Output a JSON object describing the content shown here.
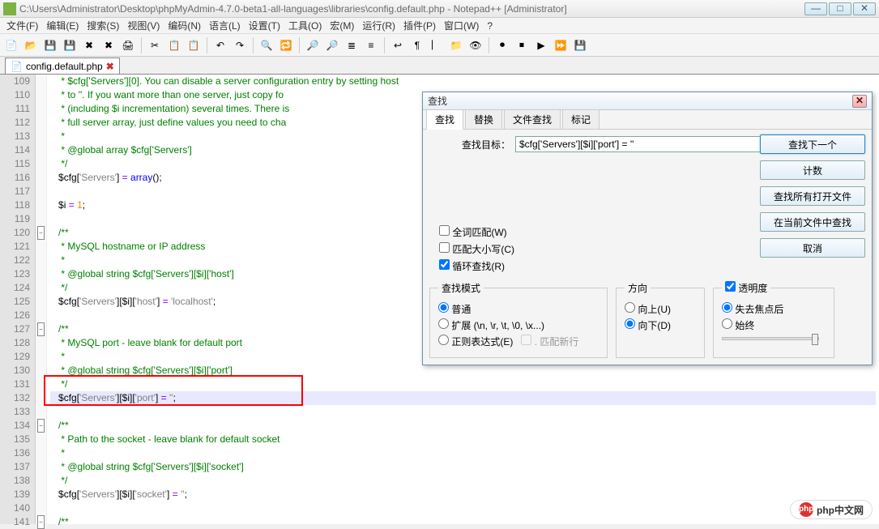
{
  "window": {
    "title": "C:\\Users\\Administrator\\Desktop\\phpMyAdmin-4.7.0-beta1-all-languages\\libraries\\config.default.php - Notepad++ [Administrator]"
  },
  "menus": [
    "文件(F)",
    "编辑(E)",
    "搜索(S)",
    "视图(V)",
    "编码(N)",
    "语言(L)",
    "设置(T)",
    "工具(O)",
    "宏(M)",
    "运行(R)",
    "插件(P)",
    "窗口(W)",
    "?"
  ],
  "tab": {
    "filename": "config.default.php"
  },
  "lines": [
    {
      "n": 109,
      "html": "    <span class='cm'>* $cfg['Servers'][0]. You can disable a server configuration entry by setting host</span>"
    },
    {
      "n": 110,
      "html": "    <span class='cm'>* to ''. If you want more than one server, just copy fo</span>"
    },
    {
      "n": 111,
      "html": "    <span class='cm'>* (including $i incrementation) several times. There is</span>"
    },
    {
      "n": 112,
      "html": "    <span class='cm'>* full server array, just define values you need to cha</span>"
    },
    {
      "n": 113,
      "html": "    <span class='cm'>*</span>"
    },
    {
      "n": 114,
      "html": "    <span class='cm'>* @global array $cfg['Servers']</span>"
    },
    {
      "n": 115,
      "html": "    <span class='cm'>*/</span>"
    },
    {
      "n": 116,
      "html": "   <span class='va'>$cfg</span>[<span class='st'>'Servers'</span>] <span class='op'>=</span> <span class='kw'>array</span>();"
    },
    {
      "n": 117,
      "html": ""
    },
    {
      "n": 118,
      "html": "   <span class='va'>$i</span> <span class='op'>=</span> <span class='nu'>1</span>;"
    },
    {
      "n": 119,
      "html": ""
    },
    {
      "n": 120,
      "html": "   <span class='cm'>/**</span>",
      "fold": "-"
    },
    {
      "n": 121,
      "html": "    <span class='cm'>* MySQL hostname or IP address</span>"
    },
    {
      "n": 122,
      "html": "    <span class='cm'>*</span>"
    },
    {
      "n": 123,
      "html": "    <span class='cm'>* @global string $cfg['Servers'][$i]['host']</span>"
    },
    {
      "n": 124,
      "html": "    <span class='cm'>*/</span>"
    },
    {
      "n": 125,
      "html": "   <span class='va'>$cfg</span>[<span class='st'>'Servers'</span>][<span class='va'>$i</span>][<span class='st'>'host'</span>] <span class='op'>=</span> <span class='st'>'localhost'</span>;"
    },
    {
      "n": 126,
      "html": ""
    },
    {
      "n": 127,
      "html": "   <span class='cm'>/**</span>",
      "fold": "-"
    },
    {
      "n": 128,
      "html": "    <span class='cm'>* MySQL port - leave blank for default port</span>"
    },
    {
      "n": 129,
      "html": "    <span class='cm'>*</span>"
    },
    {
      "n": 130,
      "html": "    <span class='cm'>* @global string $cfg['Servers'][$i]['port']</span>"
    },
    {
      "n": 131,
      "html": "    <span class='cm'>*/</span>"
    },
    {
      "n": 132,
      "html": "   <span class='va'>$cfg</span>[<span class='st'>'Servers'</span>][<span class='va'>$i</span>][<span class='st'>'port'</span>] <span class='op'>=</span> <span class='st'>''</span>;",
      "hl": true
    },
    {
      "n": 133,
      "html": ""
    },
    {
      "n": 134,
      "html": "   <span class='cm'>/**</span>",
      "fold": "-"
    },
    {
      "n": 135,
      "html": "    <span class='cm'>* Path to the socket - leave blank for default socket</span>"
    },
    {
      "n": 136,
      "html": "    <span class='cm'>*</span>"
    },
    {
      "n": 137,
      "html": "    <span class='cm'>* @global string $cfg['Servers'][$i]['socket']</span>"
    },
    {
      "n": 138,
      "html": "    <span class='cm'>*/</span>"
    },
    {
      "n": 139,
      "html": "   <span class='va'>$cfg</span>[<span class='st'>'Servers'</span>][<span class='va'>$i</span>][<span class='st'>'socket'</span>] <span class='op'>=</span> <span class='st'>''</span>;"
    },
    {
      "n": 140,
      "html": ""
    },
    {
      "n": 141,
      "html": "   <span class='cm'>/**</span>",
      "fold": "-"
    }
  ],
  "redbox": {
    "top_line": 131,
    "height_lines": 2
  },
  "find": {
    "title": "查找",
    "tabs": [
      "查找",
      "替换",
      "文件查找",
      "标记"
    ],
    "active_tab": 0,
    "target_label": "查找目标：",
    "target_value": "$cfg['Servers'][$i]['port'] = ''",
    "buttons": {
      "find_next": "查找下一个",
      "count": "计数",
      "find_all_open": "查找所有打开文件",
      "find_in_current": "在当前文件中查找",
      "cancel": "取消"
    },
    "options": {
      "whole_word": "全词匹配(W)",
      "match_case": "匹配大小写(C)",
      "wrap": "循环查找(R)",
      "wrap_checked": true
    },
    "mode": {
      "legend": "查找模式",
      "normal": "普通",
      "extended": "扩展 (\\n, \\r, \\t, \\0, \\x...)",
      "regex": "正则表达式(E)",
      "dot_newline": ". 匹配新行",
      "selected": "normal"
    },
    "direction": {
      "legend": "方向",
      "up": "向上(U)",
      "down": "向下(D)",
      "selected": "down"
    },
    "transparency": {
      "legend": "透明度",
      "enabled": true,
      "on_blur": "失去焦点后",
      "always": "始终",
      "selected": "on_blur"
    }
  },
  "watermark": "php中文网"
}
